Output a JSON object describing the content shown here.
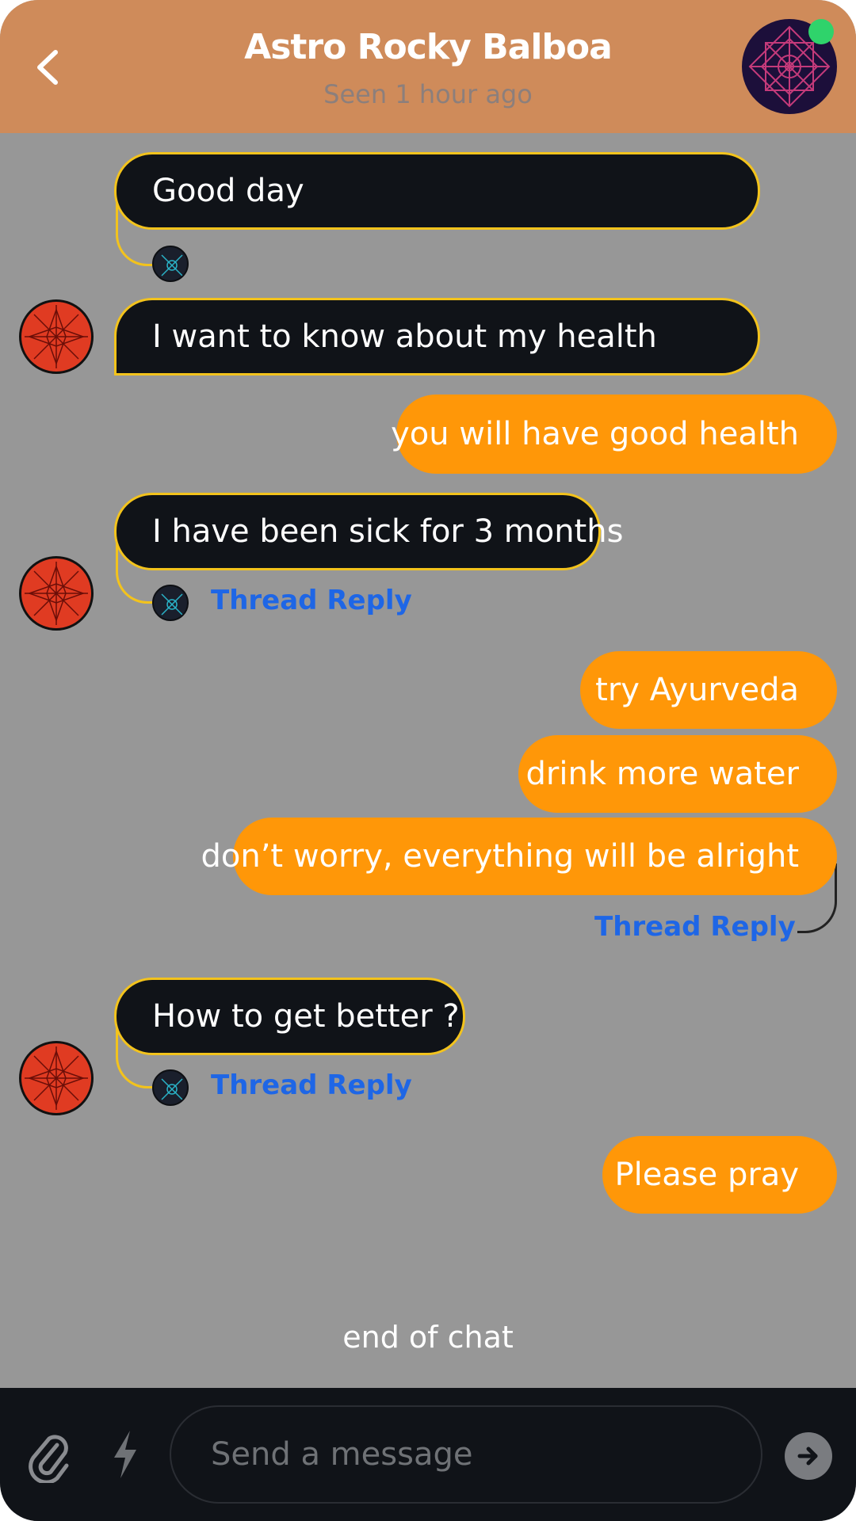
{
  "header": {
    "title": "Astro Rocky Balboa",
    "subtitle": "Seen 1 hour ago",
    "back_icon": "chevron-left-icon",
    "avatar_icon": "geometric-mandala-avatar",
    "online_color": "#2fd36b"
  },
  "messages": [
    {
      "from": "user",
      "text": "Good day"
    },
    {
      "from": "user",
      "text": "I want to know about my health"
    },
    {
      "from": "astrologer",
      "text": "you will have good health"
    },
    {
      "from": "user",
      "text": "I have been sick for 3 months",
      "thread_reply": "Thread Reply"
    },
    {
      "from": "astrologer",
      "text": "try Ayurveda"
    },
    {
      "from": "astrologer",
      "text": "drink more water"
    },
    {
      "from": "astrologer",
      "text": "don’t worry, everything will be alright",
      "thread_reply": "Thread Reply"
    },
    {
      "from": "user",
      "text": "How to get better ?",
      "thread_reply": "Thread Reply"
    },
    {
      "from": "astrologer",
      "text": "Please pray"
    }
  ],
  "end_label": "end of chat",
  "composer": {
    "placeholder": "Send a message",
    "attach_icon": "paperclip-icon",
    "commands_icon": "lightning-icon",
    "send_icon": "arrow-right-icon"
  },
  "colors": {
    "header_bg": "#cf8b5a",
    "chat_bg": "#979797",
    "incoming_bubble": "#101318",
    "incoming_border": "#f3c31c",
    "outgoing_bubble": "#ff9708",
    "thread_link": "#1e66e6",
    "composer_bg": "#101318"
  }
}
